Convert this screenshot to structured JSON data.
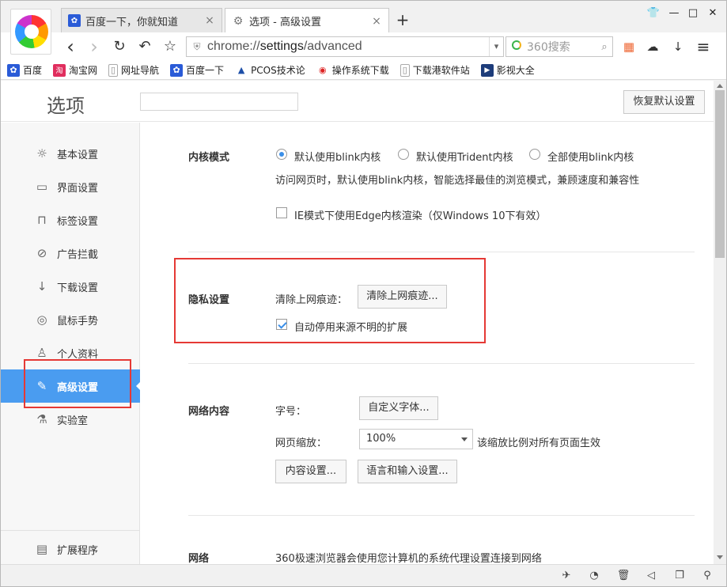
{
  "tabs": [
    {
      "title": "百度一下，你就知道",
      "icon": "paw-icon",
      "close": "×"
    },
    {
      "title": "选项 - 高级设置",
      "icon": "gear-icon",
      "close": "×"
    }
  ],
  "new_tab_symbol": "+",
  "window_controls": {
    "skin": "👕",
    "minimize": "—",
    "maximize": "□",
    "close": "✕"
  },
  "nav": {
    "back": "‹",
    "forward": "›",
    "reload": "↻",
    "undo": "↶",
    "favorite": "☆"
  },
  "address": {
    "prefix": "chrome://",
    "host": "settings",
    "path": "/advanced",
    "dropdown": "▾"
  },
  "search": {
    "placeholder": "360搜索",
    "button": "⌕"
  },
  "toolbar_icons": {
    "apps": "▦",
    "cloud": "☁",
    "download": "↓",
    "menu": "≡"
  },
  "bookmarks": [
    {
      "label": "百度",
      "icon": "paw-icon",
      "color": "#2a5bd7",
      "glyph": "✿"
    },
    {
      "label": "淘宝网",
      "icon": "taobao-icon",
      "color": "#e02e5e",
      "glyph": "淘"
    },
    {
      "label": "网址导航",
      "icon": "page-icon",
      "color": "#ffffff",
      "glyph": "▯"
    },
    {
      "label": "百度一下",
      "icon": "paw-icon",
      "color": "#2a5bd7",
      "glyph": "✿"
    },
    {
      "label": "PCOS技术论",
      "icon": "pcos-icon",
      "color": "#ffffff",
      "glyph": "▲"
    },
    {
      "label": "操作系统下载",
      "icon": "os-icon",
      "color": "#ffffff",
      "glyph": "◉"
    },
    {
      "label": "下载港软件站",
      "icon": "page-icon",
      "color": "#ffffff",
      "glyph": "▯"
    },
    {
      "label": "影视大全",
      "icon": "film-icon",
      "color": "#1d3c7a",
      "glyph": "▶"
    }
  ],
  "page": {
    "title": "选项",
    "search_value": "",
    "reset_label": "恢复默认设置"
  },
  "sidebar": {
    "items": [
      {
        "label": "基本设置",
        "icon": "sun-icon",
        "glyph": "☼"
      },
      {
        "label": "界面设置",
        "icon": "window-icon",
        "glyph": "▭"
      },
      {
        "label": "标签设置",
        "icon": "laptop-icon",
        "glyph": "⊓"
      },
      {
        "label": "广告拦截",
        "icon": "block-icon",
        "glyph": "⊘"
      },
      {
        "label": "下载设置",
        "icon": "download-icon",
        "glyph": "↓"
      },
      {
        "label": "鼠标手势",
        "icon": "mouse-icon",
        "glyph": "◎"
      },
      {
        "label": "个人资料",
        "icon": "person-icon",
        "glyph": "♙"
      },
      {
        "label": "高级设置",
        "icon": "wrench-icon",
        "glyph": "✎"
      },
      {
        "label": "实验室",
        "icon": "flask-icon",
        "glyph": "⚗"
      }
    ],
    "extensions": {
      "label": "扩展程序",
      "icon": "extension-icon",
      "glyph": "▤"
    }
  },
  "kernel": {
    "label": "内核模式",
    "options": [
      "默认使用blink内核",
      "默认使用Trident内核",
      "全部使用blink内核"
    ],
    "selected_index": 0,
    "description": "访问网页时，默认使用blink内核，智能选择最佳的浏览模式，兼顾速度和兼容性",
    "ie_edge_label": "IE模式下使用Edge内核渲染（仅Windows 10下有效）",
    "ie_edge_checked": false
  },
  "privacy": {
    "label": "隐私设置",
    "clear_label": "清除上网痕迹：",
    "clear_button": "清除上网痕迹...",
    "disable_ext_label": "自动停用来源不明的扩展",
    "disable_ext_checked": true
  },
  "web_content": {
    "label": "网络内容",
    "font_size_label": "字号：",
    "custom_font_button": "自定义字体...",
    "zoom_label": "网页缩放：",
    "zoom_value": "100%",
    "zoom_note": "该缩放比例对所有页面生效",
    "content_settings_button": "内容设置...",
    "language_button": "语言和输入设置..."
  },
  "network": {
    "label": "网络",
    "description": "360极速浏览器会使用您计算机的系统代理设置连接到网络"
  },
  "statusbar_icons": [
    "pin-icon",
    "compass-icon",
    "trash-icon",
    "speaker-icon",
    "window-icon",
    "zoom-icon"
  ],
  "accent_color": "#4a9cf0",
  "highlight_color": "#e53935"
}
